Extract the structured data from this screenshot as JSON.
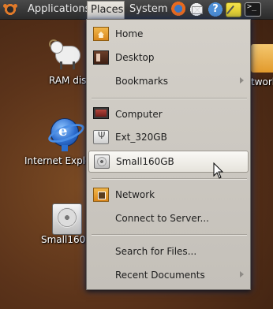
{
  "panel": {
    "menus": {
      "applications": "Applications",
      "places": "Places",
      "system": "System"
    },
    "tray_icons": [
      "firefox-icon",
      "mail-icon",
      "help-icon",
      "notes-icon",
      "terminal-icon"
    ],
    "help_glyph": "?",
    "terminal_glyph": ">_"
  },
  "desktop": {
    "icons": [
      {
        "label": "RAM dis",
        "icon": "ram-sheep-icon"
      },
      {
        "label": "Internet Explo",
        "icon": "internet-explorer-icon"
      },
      {
        "label": "Small160",
        "icon": "hard-drive-icon"
      },
      {
        "label": "twork",
        "icon": "network-folder-icon"
      }
    ]
  },
  "places_menu": {
    "items": [
      {
        "label": "Home",
        "icon": "home-folder-icon"
      },
      {
        "label": "Desktop",
        "icon": "desktop-folder-icon"
      },
      {
        "label": "Bookmarks",
        "submenu": true
      },
      {
        "label": "Computer",
        "icon": "computer-icon"
      },
      {
        "label": "Ext_320GB",
        "icon": "usb-drive-icon"
      },
      {
        "label": "Small160GB",
        "icon": "hard-drive-icon",
        "highlighted": true
      },
      {
        "label": "Network",
        "icon": "network-folder-icon"
      },
      {
        "label": "Connect to Server..."
      },
      {
        "label": "Search for Files..."
      },
      {
        "label": "Recent Documents",
        "submenu": true
      }
    ],
    "usb_glyph": "Ψ"
  },
  "colors": {
    "panel": "#2b2b2b",
    "menu_background": "#d4d0c9",
    "highlight": "#f5f3ee",
    "accent_orange": "#e07a2a"
  }
}
